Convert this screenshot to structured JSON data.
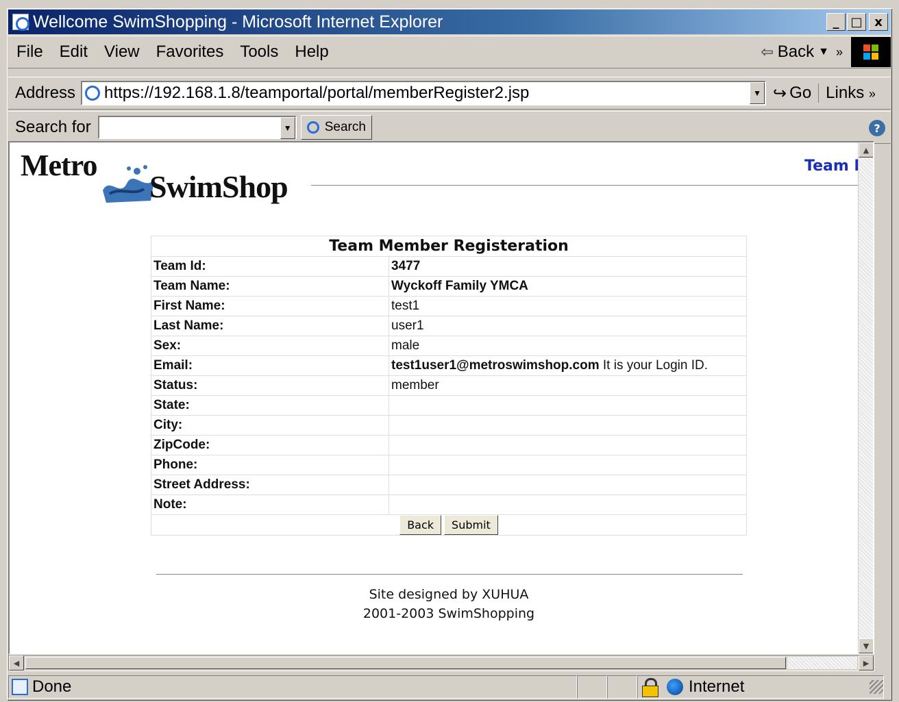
{
  "window": {
    "title": "Wellcome SwimShopping - Microsoft Internet Explorer",
    "minimize": "_",
    "maximize": "□",
    "close": "x"
  },
  "menu": {
    "file": "File",
    "edit": "Edit",
    "view": "View",
    "favorites": "Favorites",
    "tools": "Tools",
    "help": "Help",
    "back": "Back",
    "more": "»"
  },
  "address": {
    "label": "Address",
    "url": "https://192.168.1.8/teamportal/portal/memberRegister2.jsp",
    "go": "Go",
    "links": "Links",
    "more": "»"
  },
  "search": {
    "label": "Search for",
    "value": "",
    "button": "Search",
    "help": "?"
  },
  "page": {
    "logo_line1": "Metro",
    "logo_line2": "SwimShop",
    "team_portal_link": "Team Po",
    "form": {
      "caption": "Team Member Registeration",
      "rows": [
        {
          "label": "Team Id:",
          "value": "3477",
          "bold": true
        },
        {
          "label": "Team Name:",
          "value": "Wyckoff Family YMCA",
          "bold": true
        },
        {
          "label": "First Name:",
          "value": "test1",
          "bold": false
        },
        {
          "label": "Last Name:",
          "value": " user1",
          "bold": false
        },
        {
          "label": "Sex:",
          "value": "male",
          "bold": false
        },
        {
          "label": "Email:",
          "value": "test1user1@metroswimshop.com",
          "bold": true,
          "suffix": " It is your Login ID."
        },
        {
          "label": "Status:",
          "value": "member",
          "bold": false
        },
        {
          "label": "State:",
          "value": "",
          "bold": false
        },
        {
          "label": "City:",
          "value": "",
          "bold": false
        },
        {
          "label": "ZipCode:",
          "value": "",
          "bold": false
        },
        {
          "label": "Phone:",
          "value": "",
          "bold": false
        },
        {
          "label": "Street Address:",
          "value": "",
          "bold": false
        },
        {
          "label": "Note:",
          "value": "",
          "bold": false
        }
      ],
      "back_button": "Back",
      "submit_button": "Submit"
    },
    "footer": {
      "line1": "Site designed by XUHUA",
      "line2": "2001-2003 SwimShopping"
    }
  },
  "status": {
    "text": "Done",
    "zone": "Internet"
  },
  "colors": {
    "titlebar": "#0a246a",
    "link": "#1b2eb5",
    "chrome": "#d4d0c8"
  }
}
